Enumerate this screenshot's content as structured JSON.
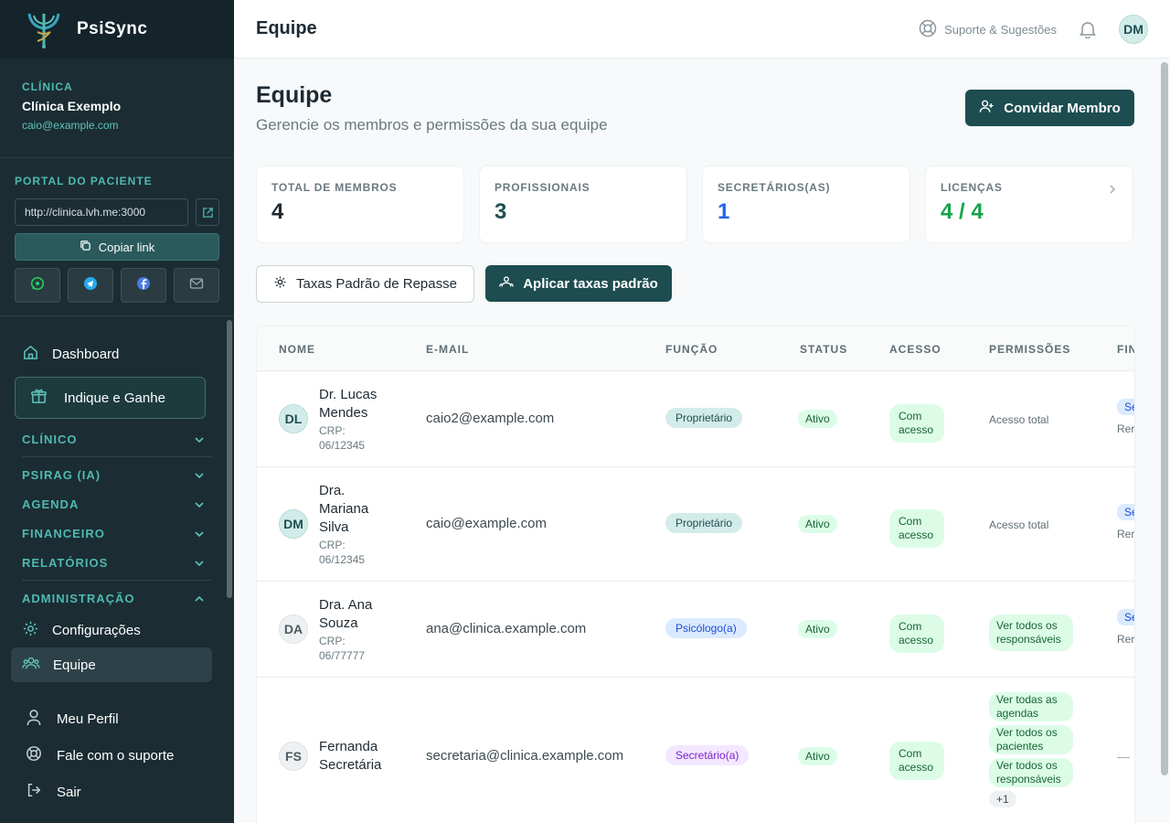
{
  "brand": {
    "name": "PsiSync"
  },
  "clinic": {
    "label": "CLÍNICA",
    "name": "Clínica Exemplo",
    "email": "caio@example.com"
  },
  "portal": {
    "label": "PORTAL DO PACIENTE",
    "url": "http://clinica.lvh.me:3000",
    "copy_label": "Copiar link",
    "share_icons": [
      "whatsapp-icon",
      "telegram-icon",
      "facebook-icon",
      "mail-icon"
    ]
  },
  "nav": {
    "dashboard": "Dashboard",
    "indique": "Indique e Ganhe",
    "sections": [
      "CLÍNICO",
      "PSIRAG (IA)",
      "AGENDA",
      "FINANCEIRO",
      "RELATÓRIOS",
      "ADMINISTRAÇÃO"
    ],
    "configuracoes": "Configurações",
    "equipe": "Equipe"
  },
  "bottom": {
    "perfil": "Meu Perfil",
    "suporte": "Fale com o suporte",
    "sair": "Sair"
  },
  "topbar": {
    "title": "Equipe",
    "support": "Suporte & Sugestões",
    "avatar": "DM"
  },
  "page": {
    "title": "Equipe",
    "subtitle": "Gerencie os membros e permissões da sua equipe",
    "invite": "Convidar Membro"
  },
  "stats": [
    {
      "label": "TOTAL DE MEMBROS",
      "value": "4",
      "color": "#1f2a33"
    },
    {
      "label": "PROFISSIONAIS",
      "value": "3",
      "color": "#1f4f52"
    },
    {
      "label": "SECRETÁRIOS(AS)",
      "value": "1",
      "color": "#2563eb"
    },
    {
      "label": "LICENÇAS",
      "value": "4 / 4",
      "color": "#16a34a"
    }
  ],
  "actions": {
    "taxas": "Taxas Padrão de Repasse",
    "aplicar": "Aplicar taxas padrão"
  },
  "table": {
    "headers": [
      "NOME",
      "E-MAIL",
      "FUNÇÃO",
      "STATUS",
      "ACESSO",
      "PERMISSÕES",
      "FIN"
    ],
    "rows": [
      {
        "initials": "DL",
        "name": "Dr. Lucas Mendes",
        "name_lines": [
          "Dr. Lucas",
          "Mendes"
        ],
        "crp_label": "CRP:",
        "crp": "06/12345",
        "email": "caio2@example.com",
        "role": "Proprietário",
        "status": "Ativo",
        "access": "Com acesso",
        "perm_text": "Acesso total",
        "fin_badge": "Se",
        "fin_sub": "Rer"
      },
      {
        "initials": "DM",
        "name": "Dra. Mariana Silva",
        "name_lines": [
          "Dra.",
          "Mariana",
          "Silva"
        ],
        "crp_label": "CRP:",
        "crp": "06/12345",
        "email": "caio@example.com",
        "role": "Proprietário",
        "status": "Ativo",
        "access": "Com acesso",
        "perm_text": "Acesso total",
        "fin_badge": "Se",
        "fin_sub": "Rer"
      },
      {
        "initials": "DA",
        "name": "Dra. Ana Souza",
        "name_lines": [
          "Dra. Ana",
          "Souza"
        ],
        "crp_label": "CRP:",
        "crp": "06/77777",
        "email": "ana@clinica.example.com",
        "role": "Psicólogo(a)",
        "status": "Ativo",
        "access": "Com acesso",
        "perm_chip": "Ver todos os responsáveis",
        "fin_badge": "Se",
        "fin_sub": "Rer"
      },
      {
        "initials": "FS",
        "name": "Fernanda Secretária",
        "name_lines": [
          "Fernanda",
          "Secretária"
        ],
        "email": "secretaria@clinica.example.com",
        "role": "Secretário(a)",
        "status": "Ativo",
        "access": "Com acesso",
        "perm_chips": [
          "Ver todas as agendas",
          "Ver todos os pacientes",
          "Ver todos os responsáveis"
        ],
        "perm_more": "+1",
        "fin_dash": "—"
      }
    ]
  }
}
